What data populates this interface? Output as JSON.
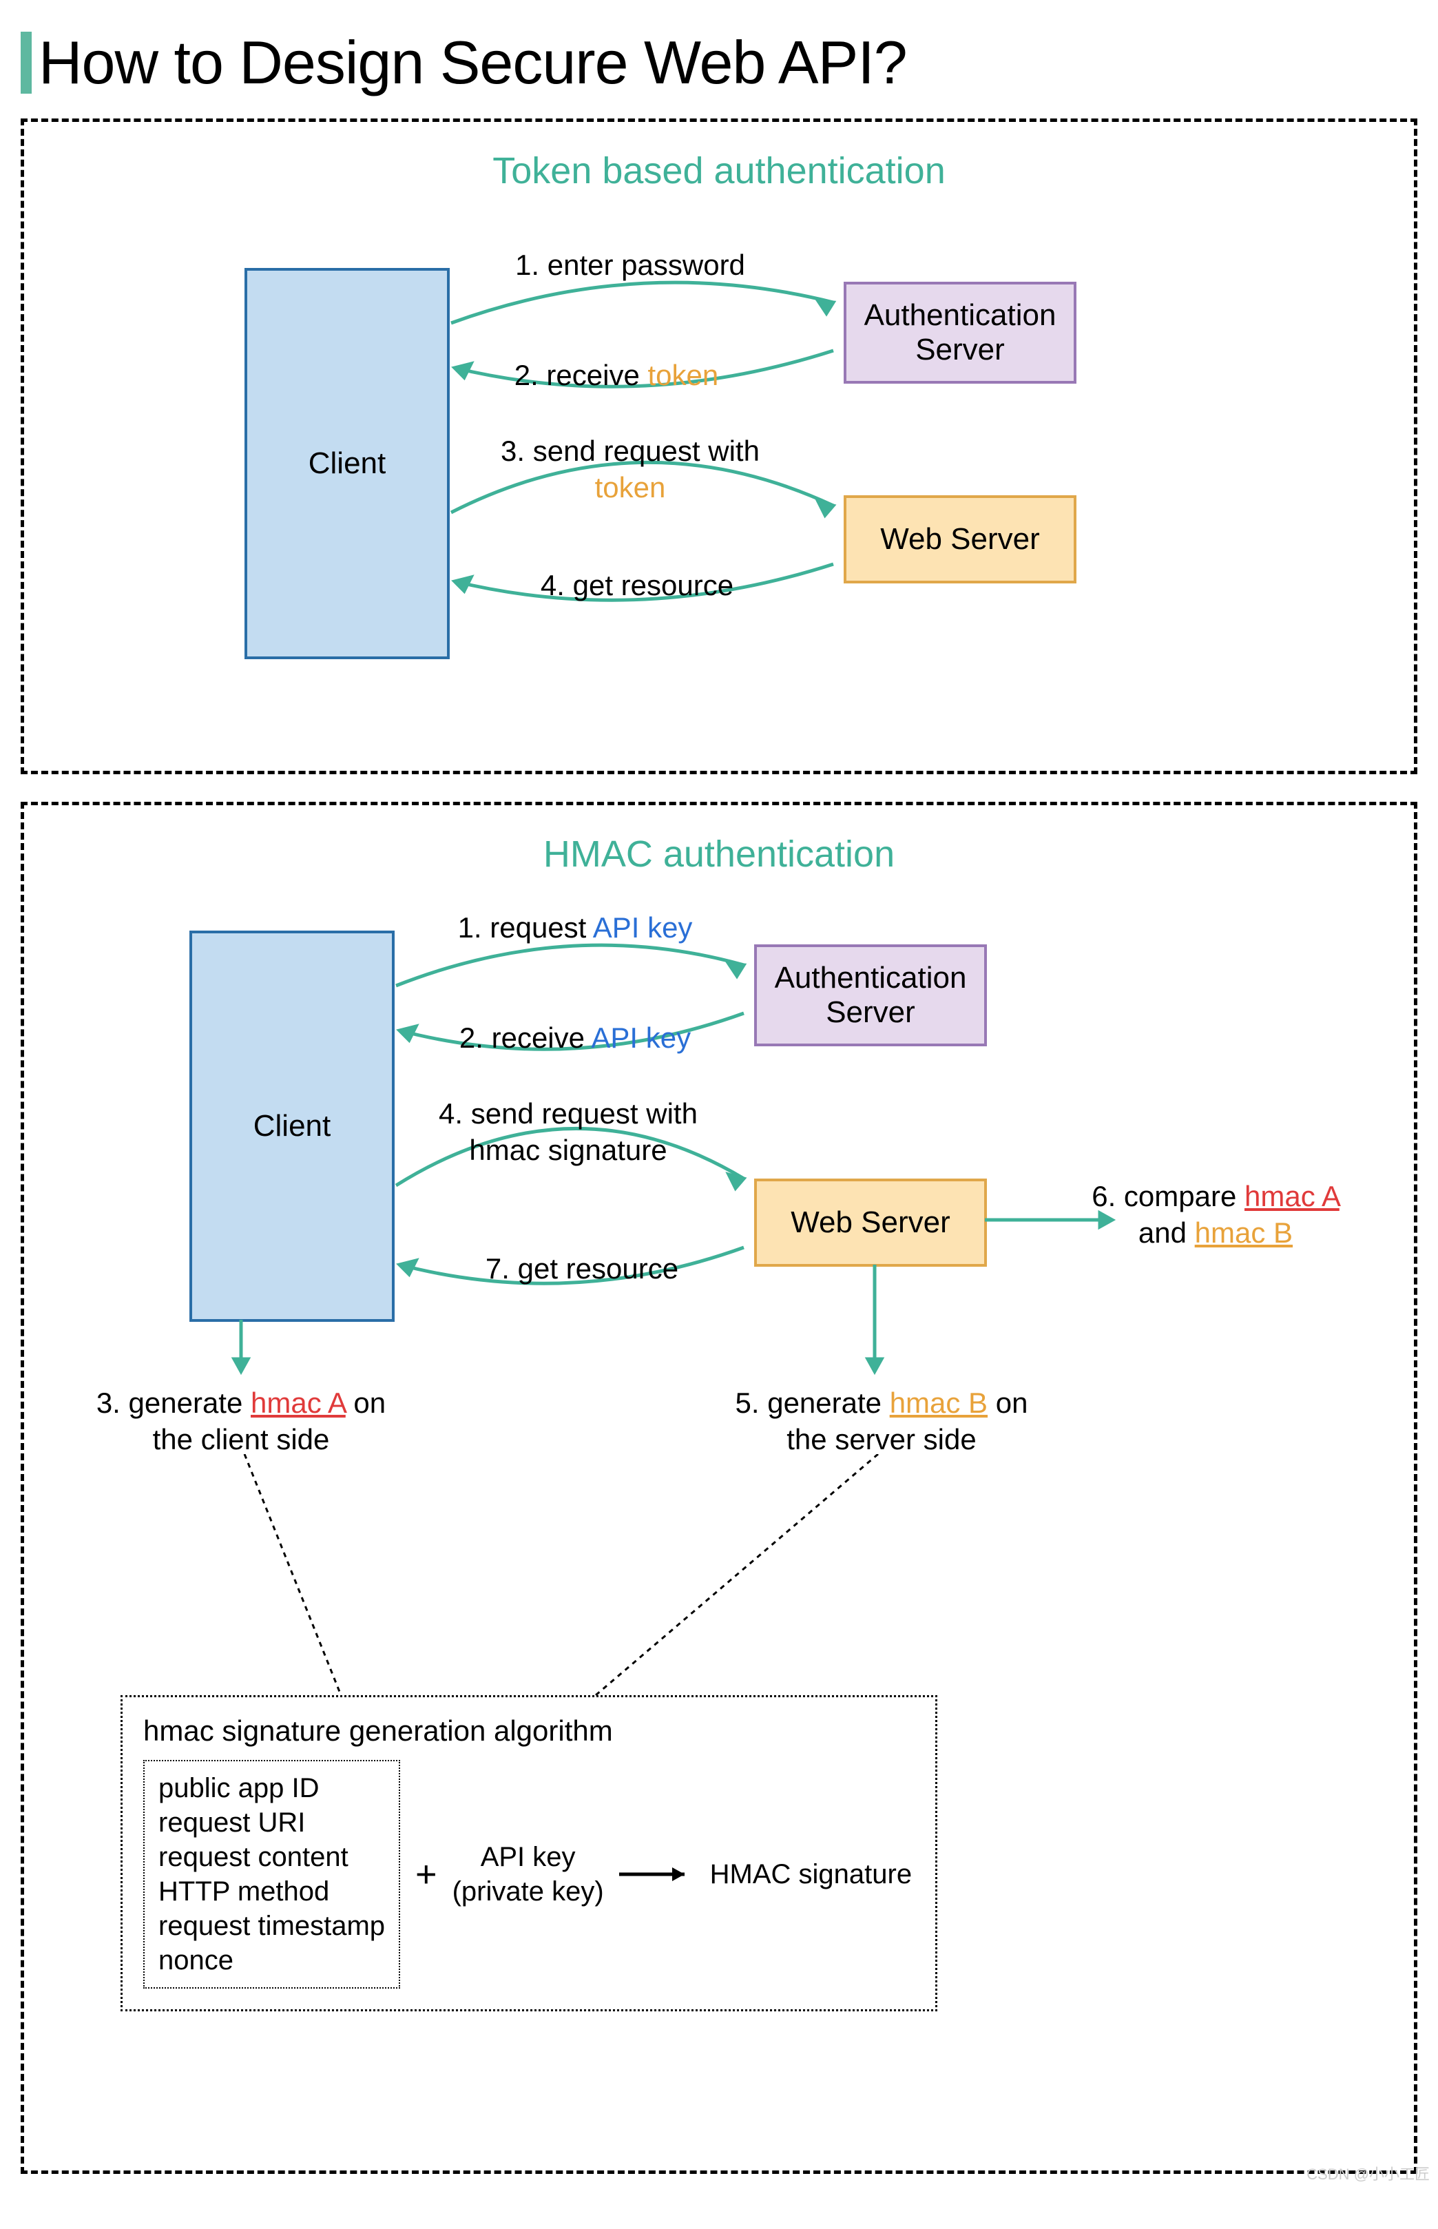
{
  "page": {
    "title": "How to Design Secure Web API?",
    "watermark": "CSDN @小小工匠"
  },
  "token_panel": {
    "title": "Token based authentication",
    "client": "Client",
    "auth_server": "Authentication Server",
    "web_server": "Web Server",
    "step1": "1. enter password",
    "step2_pre": "2. receive ",
    "step2_tok": "token",
    "step3_pre": "3.  send request with ",
    "step3_tok": "token",
    "step4": "4. get resource"
  },
  "hmac_panel": {
    "title": "HMAC authentication",
    "client": "Client",
    "auth_server": "Authentication Server",
    "web_server": "Web Server",
    "step1_pre": "1. request ",
    "step1_key": "API key",
    "step2_pre": "2. receive ",
    "step2_key": "API key",
    "step3_pre": "3. generate ",
    "step3_hmac": "hmac A",
    "step3_post": " on the client side",
    "step4": "4. send request with hmac signature",
    "step5_pre": "5. generate ",
    "step5_hmac": "hmac B",
    "step5_post": " on the server side",
    "step6_pre": "6. compare ",
    "step6_a": "hmac A",
    "step6_mid": " and ",
    "step6_b": "hmac B",
    "step7": "7. get resource",
    "algo_title": "hmac signature generation algorithm",
    "inputs": [
      "public app ID",
      "request URI",
      "request content",
      "HTTP method",
      "request timestamp",
      "nonce"
    ],
    "plus": "+",
    "apikey_line1": "API key",
    "apikey_line2": "(private key)",
    "output": "HMAC signature"
  }
}
